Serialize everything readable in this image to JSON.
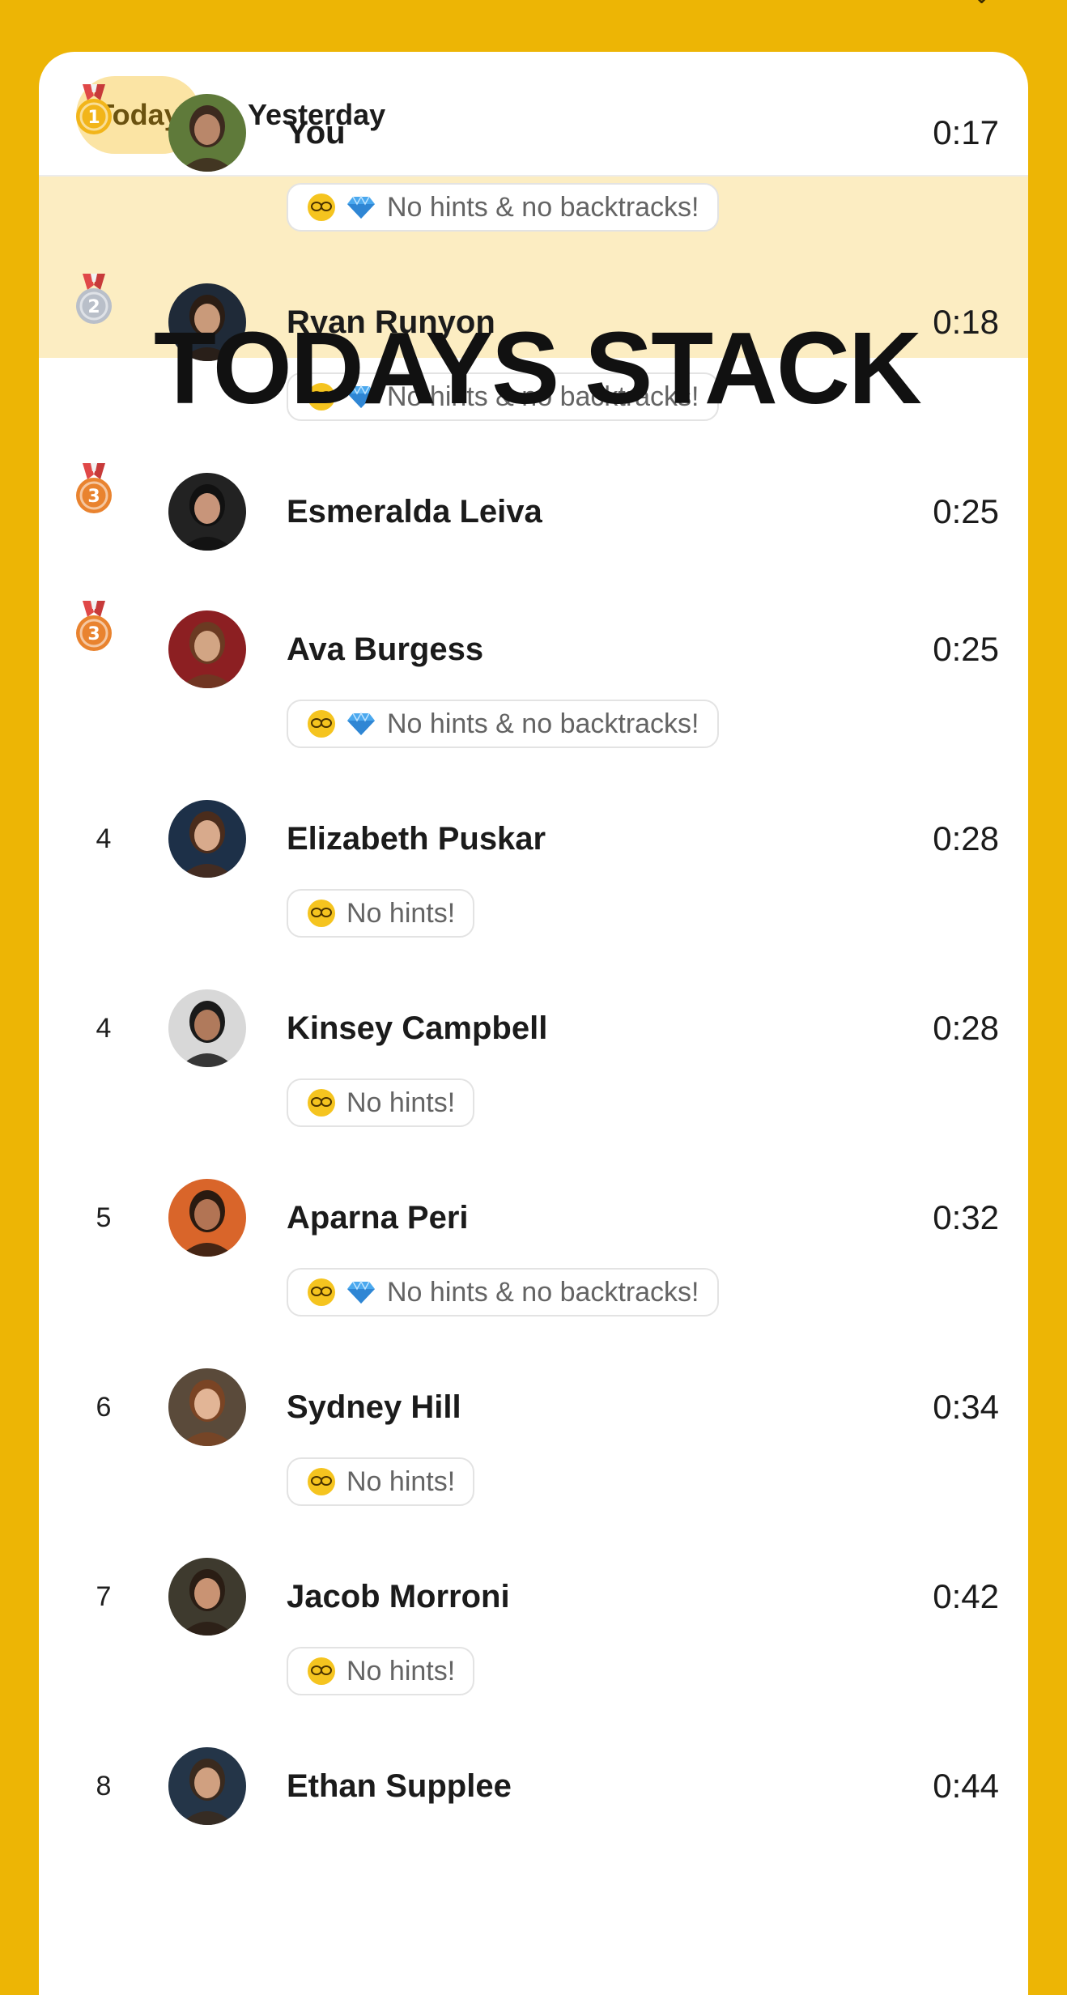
{
  "tabs": [
    {
      "label": "Today",
      "active": true
    },
    {
      "label": "Yesterday",
      "active": false
    }
  ],
  "overlay_title": "TODAYS STACK",
  "badges": {
    "both": "No hints & no backtracks!",
    "hints": "No hints!"
  },
  "leaderboard": [
    {
      "rank": "1",
      "medal": "gold",
      "name": "You",
      "time": "0:17",
      "badge": "both",
      "highlight": true
    },
    {
      "rank": "2",
      "medal": "silver",
      "name": "Ryan Runyon",
      "time": "0:18",
      "badge": "both"
    },
    {
      "rank": "3",
      "medal": "bronze",
      "name": "Esmeralda Leiva",
      "time": "0:25",
      "badge": null
    },
    {
      "rank": "3",
      "medal": "bronze",
      "name": "Ava Burgess",
      "time": "0:25",
      "badge": "both"
    },
    {
      "rank": "4",
      "medal": null,
      "name": "Elizabeth Puskar",
      "time": "0:28",
      "badge": "hints"
    },
    {
      "rank": "4",
      "medal": null,
      "name": "Kinsey Campbell",
      "time": "0:28",
      "badge": "hints"
    },
    {
      "rank": "5",
      "medal": null,
      "name": "Aparna Peri",
      "time": "0:32",
      "badge": "both"
    },
    {
      "rank": "6",
      "medal": null,
      "name": "Sydney Hill",
      "time": "0:34",
      "badge": "hints"
    },
    {
      "rank": "7",
      "medal": null,
      "name": "Jacob Morroni",
      "time": "0:42",
      "badge": "hints"
    },
    {
      "rank": "8",
      "medal": null,
      "name": "Ethan Supplee",
      "time": "0:44",
      "badge": null
    }
  ],
  "colors": {
    "background": "#EDB505",
    "active_tab": "#FBE4A4",
    "highlight_row": "#FCEDC2",
    "gold": "#F2B51A",
    "silver": "#B9BFC9",
    "bronze": "#E9832F"
  }
}
